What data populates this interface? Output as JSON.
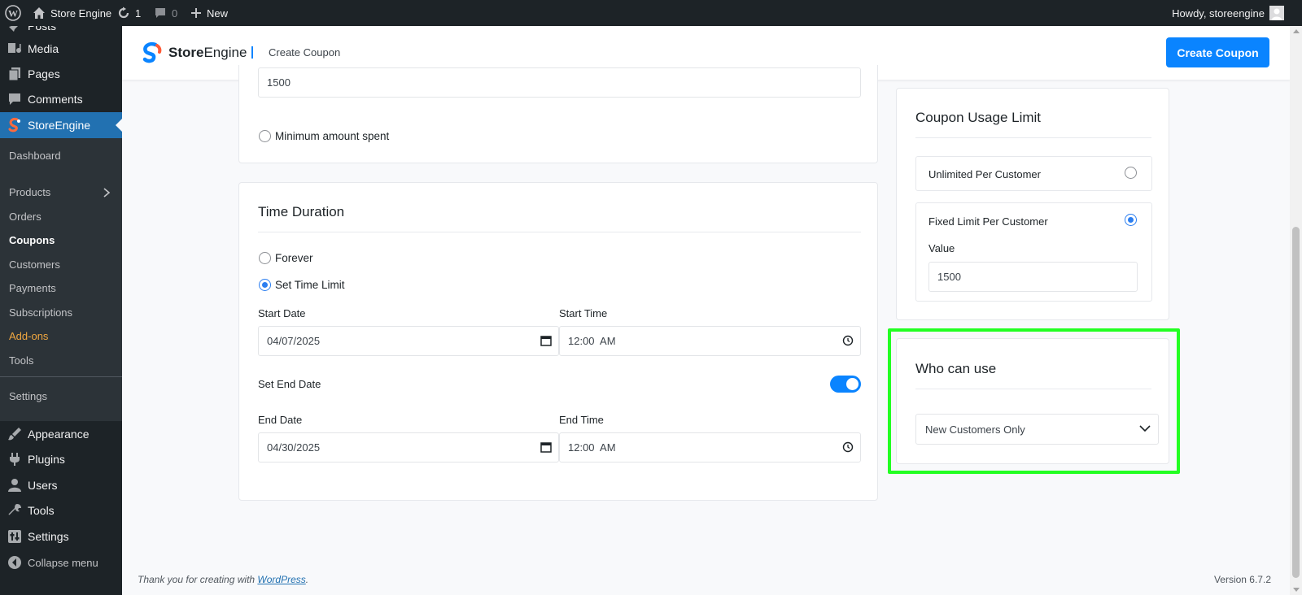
{
  "admin_bar": {
    "site_name": "Store Engine",
    "updates_count": "1",
    "comments_count": "0",
    "new_label": "New",
    "howdy": "Howdy, storeengine"
  },
  "sidebar": {
    "partial_label": "Posts",
    "top_items": [
      {
        "label": "Media",
        "icon": "media-icon"
      },
      {
        "label": "Pages",
        "icon": "pages-icon"
      },
      {
        "label": "Comments",
        "icon": "comments-icon"
      }
    ],
    "active_item": {
      "label": "StoreEngine",
      "icon": "storeengine-icon"
    },
    "submenu": [
      {
        "label": "Dashboard"
      },
      {
        "label": "Products"
      },
      {
        "label": "Orders"
      },
      {
        "label": "Coupons"
      },
      {
        "label": "Customers"
      },
      {
        "label": "Payments"
      },
      {
        "label": "Subscriptions"
      },
      {
        "label": "Add-ons"
      },
      {
        "label": "Tools"
      },
      {
        "label": "Settings"
      }
    ],
    "bottom_items": [
      {
        "label": "Appearance",
        "icon": "appearance-icon"
      },
      {
        "label": "Plugins",
        "icon": "plugins-icon"
      },
      {
        "label": "Users",
        "icon": "users-icon"
      },
      {
        "label": "Tools",
        "icon": "tools-icon"
      },
      {
        "label": "Settings",
        "icon": "settings-icon"
      }
    ],
    "collapse_label": "Collapse menu"
  },
  "header": {
    "logo_bold": "Store",
    "logo_light": "Engine",
    "page_title": "Create Coupon",
    "create_button": "Create Coupon"
  },
  "min_req_card": {
    "amount_value": "1500",
    "min_amount_label": "Minimum amount spent"
  },
  "time_duration": {
    "title": "Time Duration",
    "forever_label": "Forever",
    "set_time_limit_label": "Set Time Limit",
    "start_date_label": "Start Date",
    "start_date_value": "04/07/2025",
    "start_time_label": "Start Time",
    "start_time_value": "12:00  AM",
    "set_end_date_label": "Set End Date",
    "end_date_label": "End Date",
    "end_date_value": "04/30/2025",
    "end_time_label": "End Time",
    "end_time_value": "12:00  AM"
  },
  "usage_limit": {
    "title": "Coupon Usage Limit",
    "unlimited_label": "Unlimited Per Customer",
    "fixed_label": "Fixed Limit Per Customer",
    "value_label": "Value",
    "value": "1500"
  },
  "who_can_use": {
    "title": "Who can use",
    "selected": "New Customers Only"
  },
  "footer": {
    "thank_you": "Thank you for creating with ",
    "wp_link": "WordPress",
    "period": ".",
    "version": "Version 6.7.2"
  },
  "colors": {
    "accent": "#0a84ff",
    "sidebar_active": "#2271b1",
    "highlight": "#22ff22",
    "addons": "#f0a740"
  }
}
